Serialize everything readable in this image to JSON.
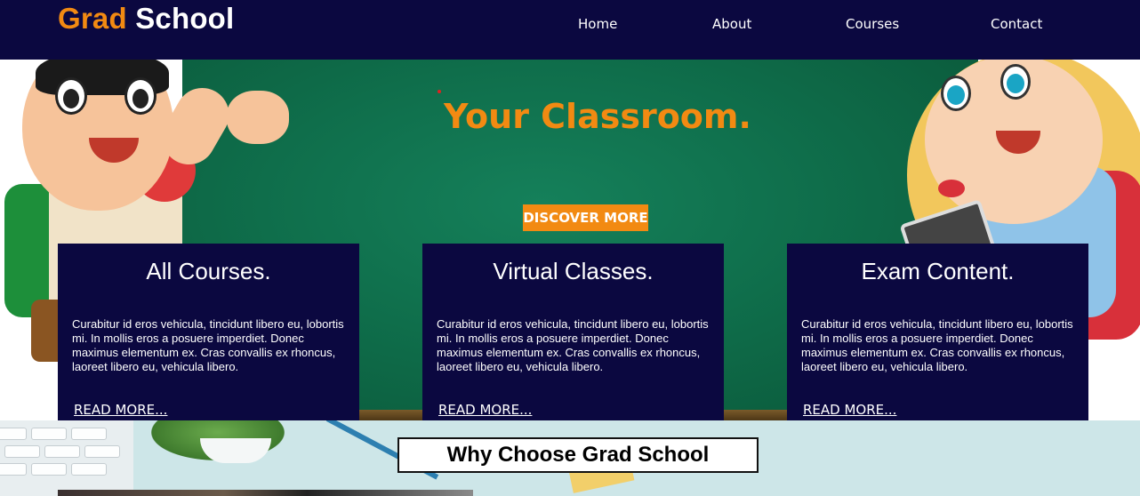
{
  "header": {
    "logo_accent": "Grad",
    "logo_rest": "School",
    "nav": [
      "Home",
      "About",
      "Courses",
      "Contact"
    ]
  },
  "hero": {
    "title": "Your Classroom.",
    "button": "DISCOVER MORE"
  },
  "cards": [
    {
      "title": "All Courses.",
      "text": "Curabitur id eros vehicula, tincidunt libero eu, lobortis mi. In mollis eros a posuere imperdiet. Donec maximus elementum ex. Cras convallis ex rhoncus, laoreet libero eu, vehicula libero.",
      "link": "READ MORE..."
    },
    {
      "title": "Virtual Classes.",
      "text": "Curabitur id eros vehicula, tincidunt libero eu, lobortis mi. In mollis eros a posuere imperdiet. Donec maximus elementum ex. Cras convallis ex rhoncus, laoreet libero eu, vehicula libero.",
      "link": "READ MORE..."
    },
    {
      "title": "Exam Content.",
      "text": "Curabitur id eros vehicula, tincidunt libero eu, lobortis mi. In mollis eros a posuere imperdiet. Donec maximus elementum ex. Cras convallis ex rhoncus, laoreet libero eu, vehicula libero.",
      "link": "READ MORE..."
    }
  ],
  "why": {
    "title": "Why Choose Grad School"
  },
  "colors": {
    "navy": "#0b0840",
    "orange": "#f28a12",
    "board_green": "#0f6e4b"
  }
}
